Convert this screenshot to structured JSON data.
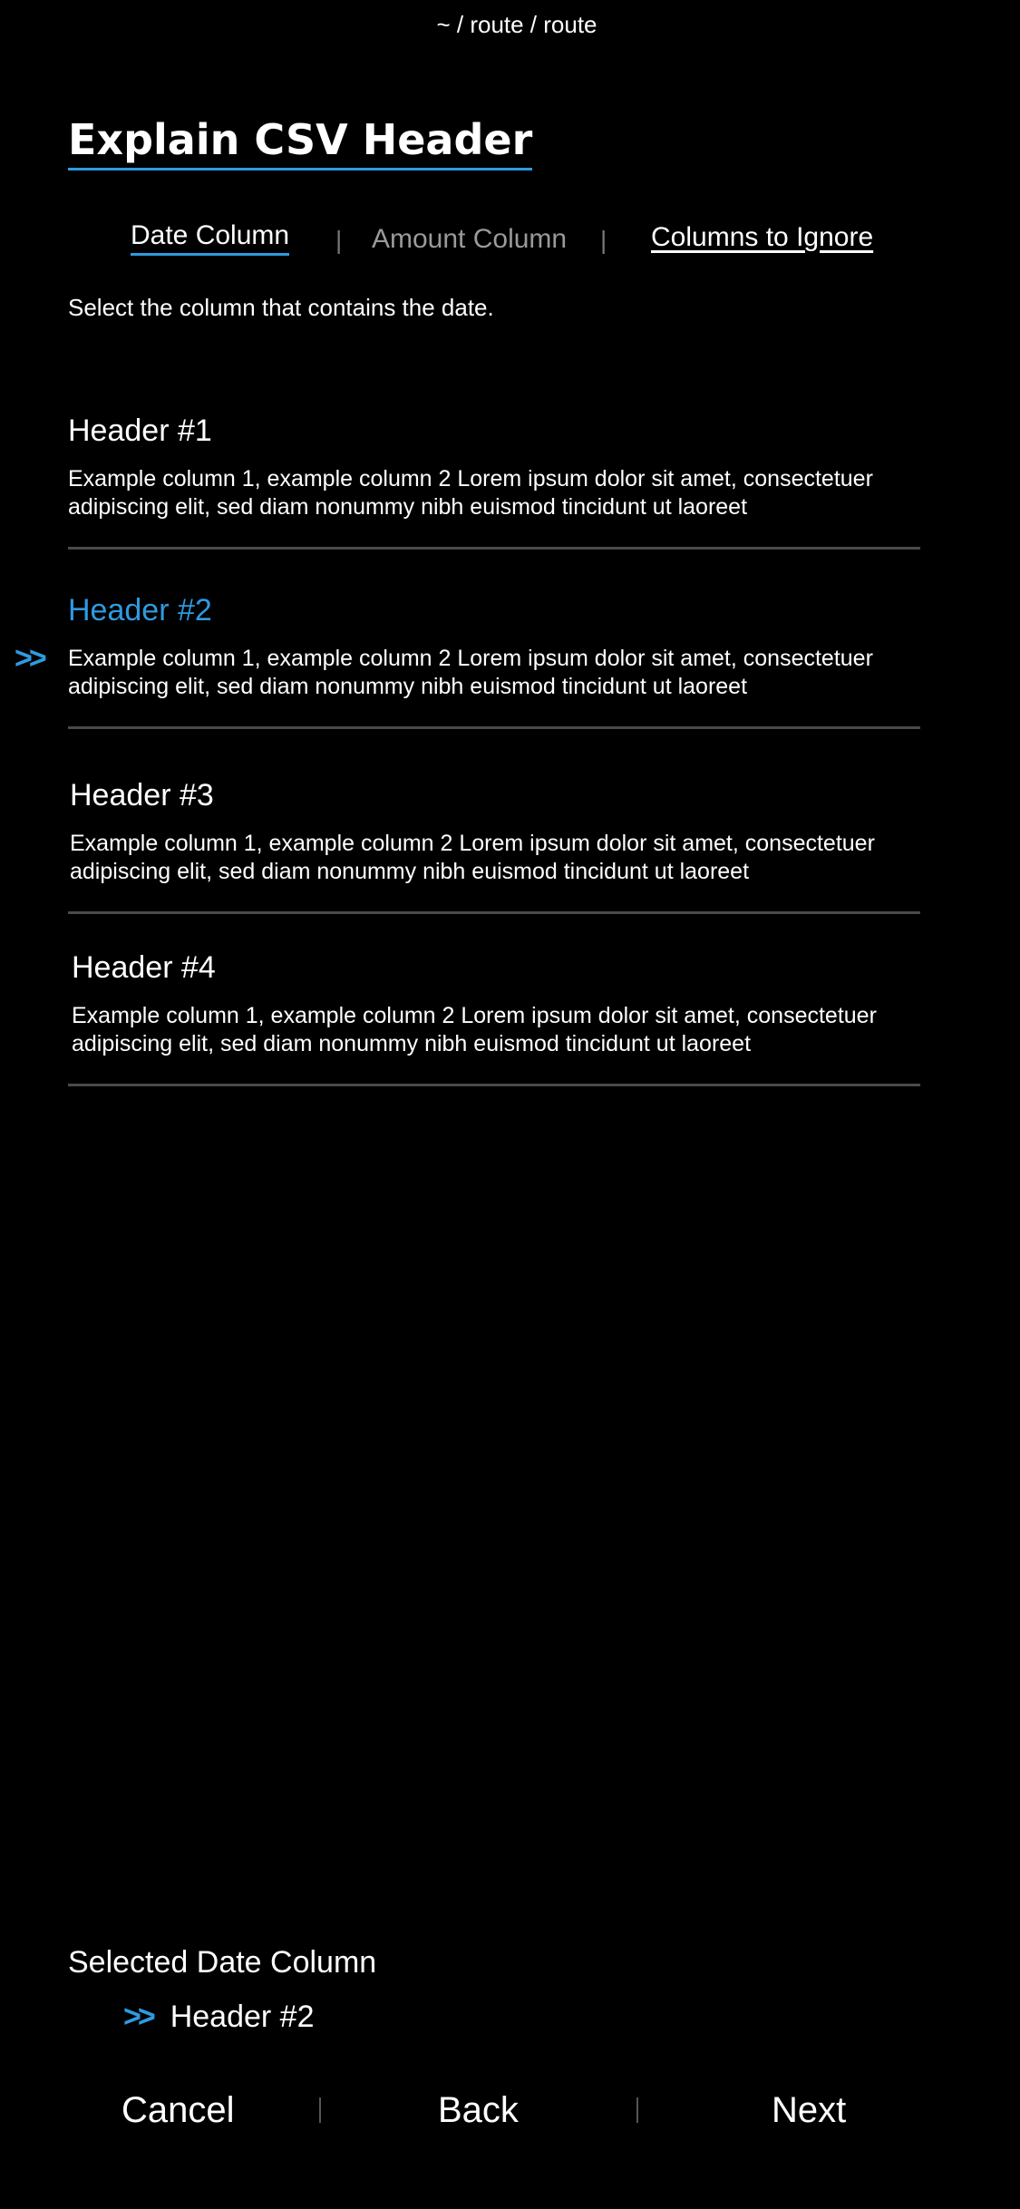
{
  "breadcrumb": "~ / route / route",
  "title": "Explain CSV Header",
  "tabs": {
    "date": "Date Column",
    "amount": "Amount Column",
    "ignore": "Columns to Ignore",
    "separator": "|"
  },
  "instruction": "Select the column that contains the date.",
  "headers": [
    {
      "title": "Header #1",
      "description": "Example column 1, example column 2 Lorem ipsum dolor sit amet, consectetuer adipiscing elit, sed diam nonummy nibh euismod tincidunt ut laoreet"
    },
    {
      "title": "Header #2",
      "description": "Example column 1, example column 2 Lorem ipsum dolor sit amet, consectetuer adipiscing elit, sed diam nonummy nibh euismod tincidunt ut laoreet"
    },
    {
      "title": "Header #3",
      "description": "Example column 1, example column 2 Lorem ipsum dolor sit amet, consectetuer adipiscing elit, sed diam nonummy nibh euismod tincidunt ut laoreet"
    },
    {
      "title": "Header #4",
      "description": "Example column 1, example column 2 Lorem ipsum dolor sit amet, consectetuer adipiscing elit, sed diam nonummy nibh euismod tincidunt ut laoreet"
    }
  ],
  "selected_marker": ">>",
  "selection": {
    "label": "Selected Date Column",
    "marker": ">>",
    "value": "Header #2"
  },
  "footer": {
    "cancel": "Cancel",
    "back": "Back",
    "next": "Next"
  },
  "colors": {
    "accent": "#2f9ae0",
    "background": "#000000",
    "text": "#ffffff",
    "muted": "#9a9a9a",
    "divider": "#4a4a4a"
  },
  "icons": {
    "selected_marker": "double-chevron-right-icon"
  }
}
